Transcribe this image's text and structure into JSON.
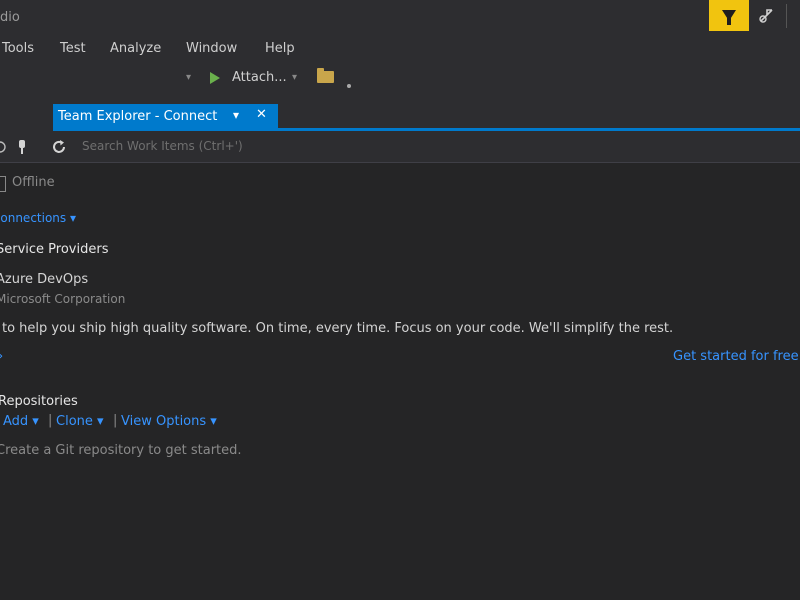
{
  "window": {
    "title": "dio"
  },
  "titlebar": {
    "filter_icon": "filter-icon",
    "share_icon": "live-share-icon"
  },
  "menu": {
    "items": [
      "Tools",
      "Test",
      "Analyze",
      "Window",
      "Help"
    ]
  },
  "toolbar": {
    "attach_label": "Attach...",
    "attach_icon": "play-icon",
    "folder_icon": "folder-icon"
  },
  "tab": {
    "label": "Team Explorer - Connect",
    "pin_glyph": "▾",
    "close_glyph": "✕"
  },
  "panel_toolbar": {
    "search_placeholder": "Search Work Items (Ctrl+')"
  },
  "status": {
    "text": "Offline"
  },
  "connections": {
    "manage_label": "Connections ▾"
  },
  "hosted": {
    "section_title": "Service Providers",
    "provider_name": "Azure DevOps",
    "provider_company": "Microsoft Corporation",
    "description": "to help you ship high quality software. On time, every time. Focus on your code. We'll simplify the rest.",
    "get_started": "Get started for free"
  },
  "git": {
    "section_title": "Repositories",
    "actions": [
      "Add ▾",
      "Clone ▾",
      "View Options ▾"
    ],
    "hint": "Create a Git repository to get started."
  },
  "colors": {
    "accent": "#007acc",
    "link": "#3794ff",
    "background": "#252526",
    "chrome": "#2d2d30",
    "highlight": "#f1c40f"
  }
}
